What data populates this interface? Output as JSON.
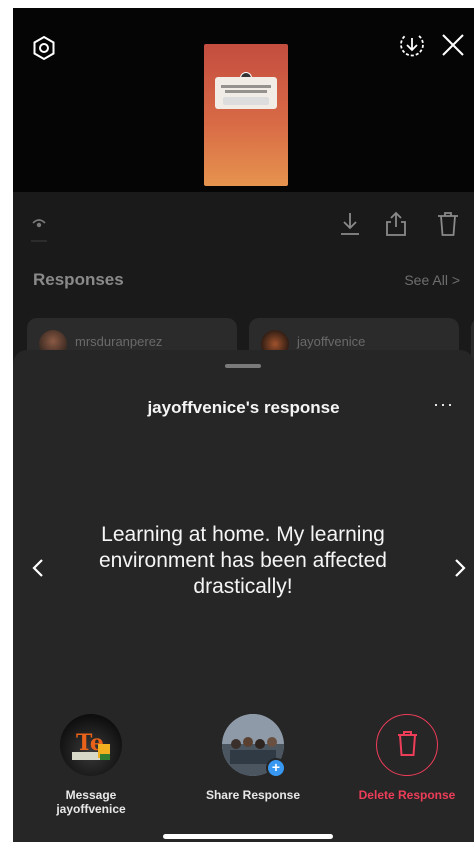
{
  "responses": {
    "title": "Responses",
    "see_all": "See All >",
    "cards": [
      {
        "username": "mrsduranperez"
      },
      {
        "username": "jayoffvenice"
      }
    ]
  },
  "sheet": {
    "title": "jayoffvenice's response",
    "more": "···",
    "response_text": "Learning at home. My learning environment has been affected drastically!",
    "actions": {
      "message": "Message jayoffvenice",
      "share": "Share Response",
      "delete": "Delete Response"
    },
    "share_badge": "+"
  },
  "colors": {
    "sheet_background": "#262626",
    "delete_accent": "#ee3d59",
    "badge_blue": "#3897f0"
  },
  "icons": [
    "settings-icon",
    "download-circle-icon",
    "close-icon",
    "eye-icon",
    "download-icon",
    "share-icon",
    "trash-icon",
    "chevron-left-icon",
    "chevron-right-icon"
  ]
}
